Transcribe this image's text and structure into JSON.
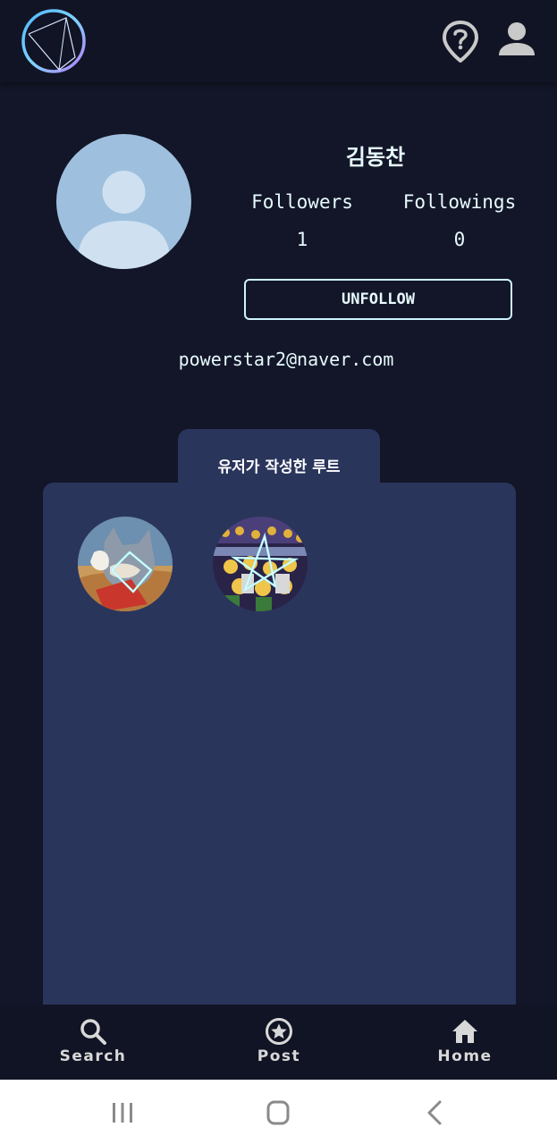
{
  "header": {
    "logo_icon": "constellation-logo-icon",
    "location_help_icon": "location-help-icon",
    "account_icon": "account-icon"
  },
  "profile": {
    "avatar_icon": "default-avatar-icon",
    "name": "김동찬",
    "followers_label": "Followers",
    "followers_count": "1",
    "followings_label": "Followings",
    "followings_count": "0",
    "unfollow_label": "UNFOLLOW",
    "email": "powerstar2@naver.com"
  },
  "routes": {
    "tab_label": "유저가 작성한 루트",
    "items": [
      {
        "thumbnail": "route-thumbnail-cartoon-cat"
      },
      {
        "thumbnail": "route-thumbnail-crowd-star"
      }
    ]
  },
  "bottom_nav": [
    {
      "label": "Search",
      "icon": "search-icon"
    },
    {
      "label": "Post",
      "icon": "star-circle-icon"
    },
    {
      "label": "Home",
      "icon": "home-icon"
    }
  ],
  "system_nav": {
    "recent_icon": "recent-apps-icon",
    "home_icon": "home-circle-icon",
    "back_icon": "back-chevron-icon"
  },
  "colors": {
    "background": "#131628",
    "topbar": "#111424",
    "panel": "#2a355c",
    "accent_text": "#e7fbff",
    "button_border": "#cdf3ff",
    "avatar_bg": "#9ec0de"
  }
}
